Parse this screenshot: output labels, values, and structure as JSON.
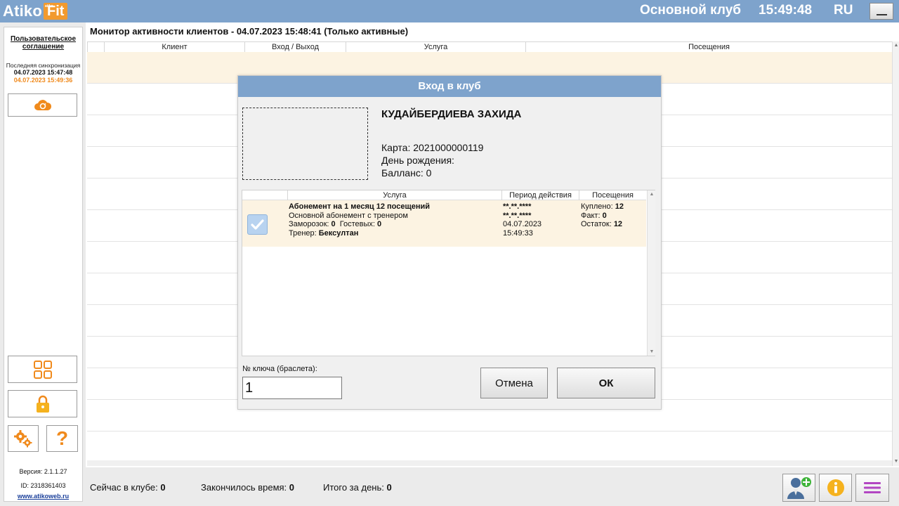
{
  "app": {
    "logo_main": "Atiko",
    "logo_badge": "Fit",
    "logo_badge_small": "atiko",
    "club_name": "Основной клуб",
    "time": "15:49:48",
    "lang": "RU"
  },
  "sidebar": {
    "agreement_line1": "Пользовательское",
    "agreement_line2": "соглашение",
    "sync_label": "Последняя синхронизация",
    "sync_time_1": "04.07.2023 15:47:48",
    "sync_time_2": "04.07.2023 15:49:36",
    "version": "Версия: 2.1.1.27",
    "id": "ID: 2318361403",
    "site": "www.atikoweb.ru"
  },
  "main": {
    "title": "Монитор активности клиентов - 04.07.2023 15:48:41 (Только активные)",
    "columns": [
      "Клиент",
      "Вход / Выход",
      "Услуга",
      "Посещения"
    ]
  },
  "footer": {
    "in_club_label": "Сейчас в клубе:",
    "in_club_value": "0",
    "time_over_label": "Закончилось время:",
    "time_over_value": "0",
    "day_total_label": "Итого за день:",
    "day_total_value": "0"
  },
  "dialog": {
    "title": "Вход в клуб",
    "client_name": "КУДАЙБЕРДИЕВА ЗАХИДА",
    "card": "Карта: 2021000000119",
    "birthday": "День рождения:",
    "balance": "Балланс: 0",
    "services": {
      "columns": [
        "Услуга",
        "Период действия",
        "Посещения"
      ],
      "rows": [
        {
          "checked": true,
          "name": "Абонемент на 1 месяц  12 посещений",
          "subtitle": "Основной абонемент с тренером",
          "freeze_label": "Заморозок:",
          "freeze_value": "0",
          "guest_label": "Гостевых:",
          "guest_value": "0",
          "trainer_label": "Тренер:",
          "trainer_value": "Бексултан",
          "period_1": "**.**.****",
          "period_2": "**.**.****",
          "period_3": "04.07.2023",
          "period_4": "15:49:33",
          "bought_label": "Куплено:",
          "bought_value": "12",
          "fact_label": "Факт:",
          "fact_value": "0",
          "rest_label": "Остаток:",
          "rest_value": "12"
        }
      ]
    },
    "key_label": "№ ключа (браслета):",
    "key_value": "1",
    "cancel": "Отмена",
    "ok": "ОК"
  },
  "colors": {
    "topbar": "#7ea3cc",
    "accent_orange": "#f08a1c",
    "selected_row": "#fcf3e2",
    "menu_purple": "#b246c2"
  }
}
